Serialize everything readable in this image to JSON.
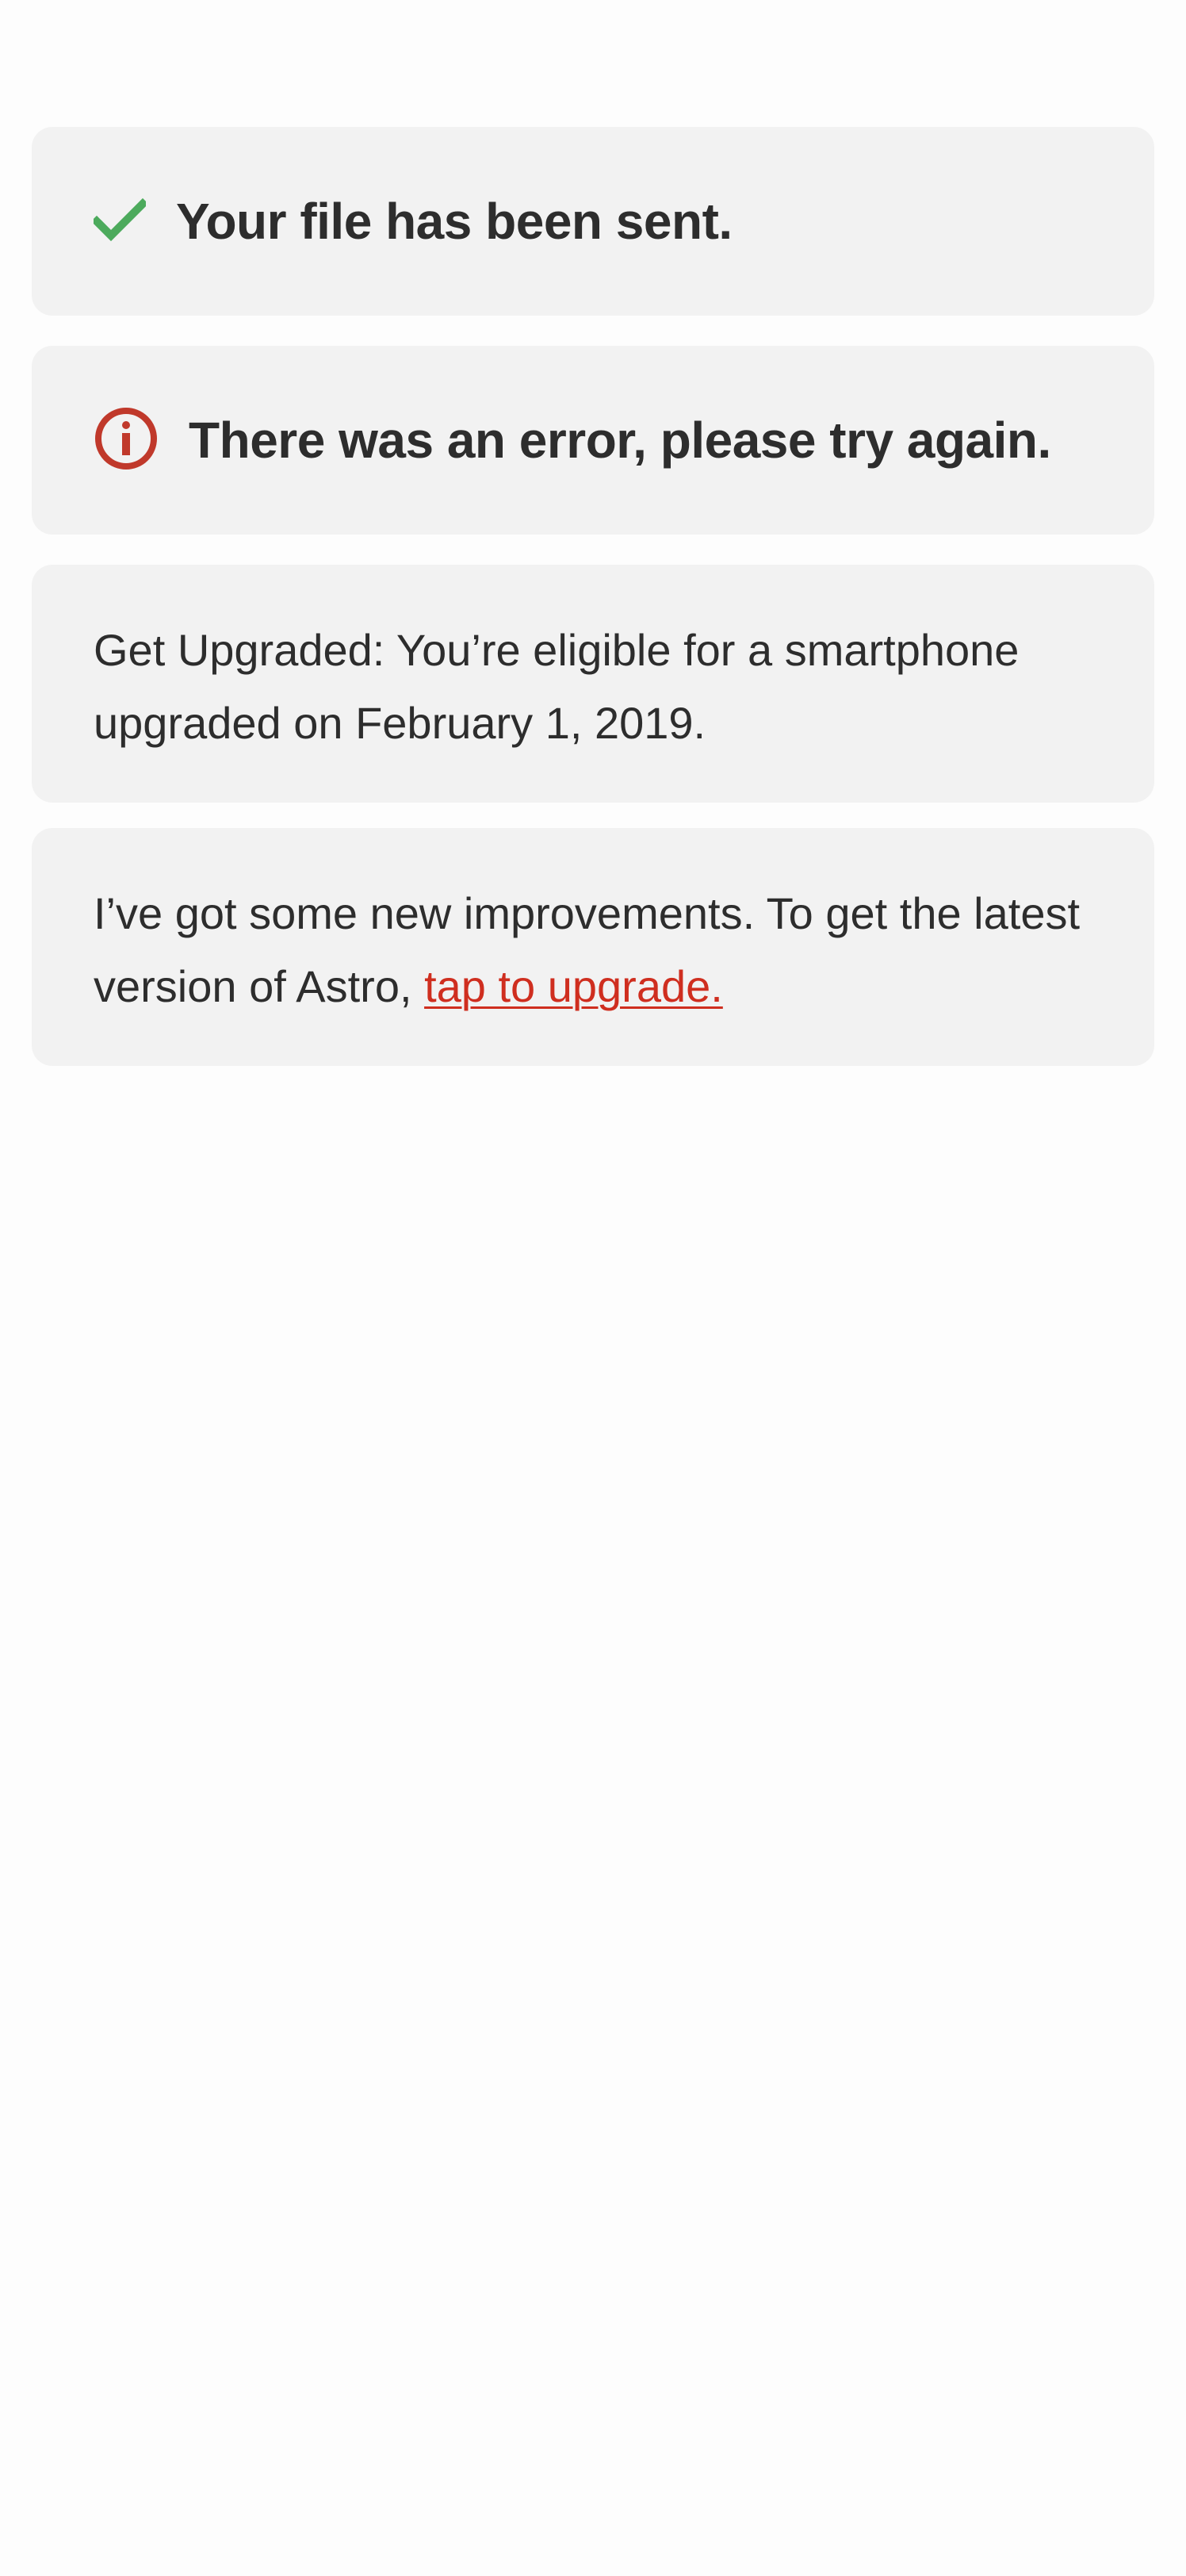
{
  "notifications": {
    "success": {
      "icon": "checkmark-icon",
      "icon_color": "#4caa5c",
      "message": "Your file has been sent."
    },
    "error": {
      "icon": "error-circle-icon",
      "icon_color": "#c0392b",
      "message": "There was an error, please try again."
    },
    "upgrade_info": {
      "text": "Get Upgraded: You’re eligible for a smartphone upgraded on February 1, 2019."
    },
    "app_update": {
      "text": "I’ve got some new improvements. To get the latest version of Astro, ",
      "link_text": "tap to upgrade.",
      "link_color": "#cf2e1f"
    }
  },
  "colors": {
    "card_background": "#f2f2f2",
    "text": "#2d2d2d",
    "page_background": "#fdfdfd"
  }
}
